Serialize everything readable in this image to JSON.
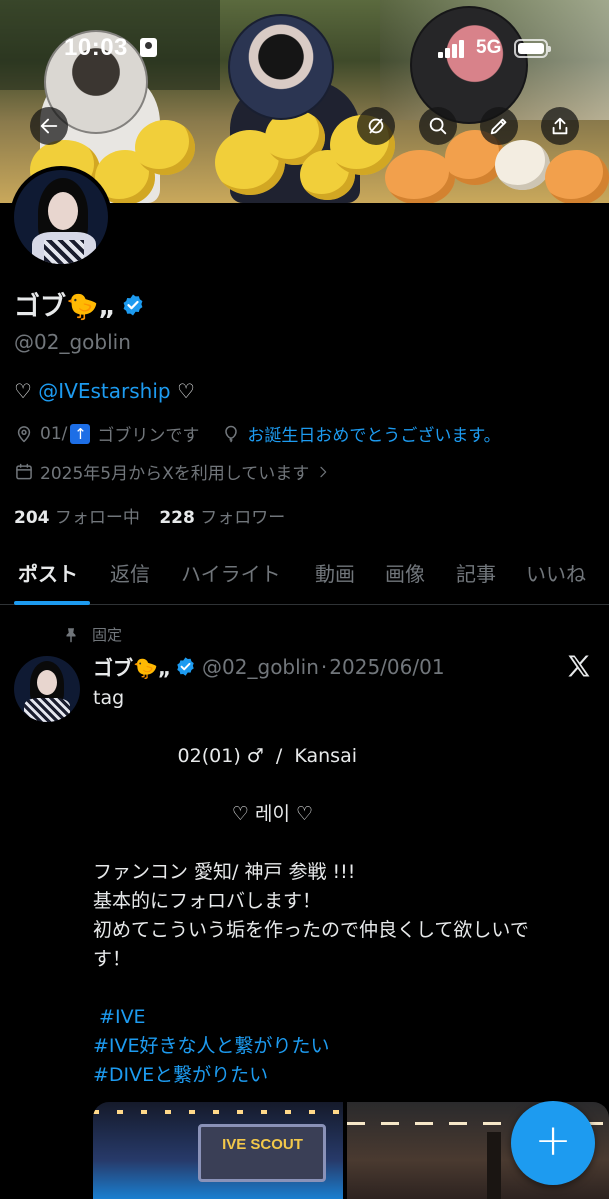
{
  "status_bar": {
    "time": "10:03",
    "network": "5G"
  },
  "header": {
    "back_icon": "arrow-left-icon",
    "actions": [
      "hide-icon",
      "search-icon",
      "edit-icon",
      "share-icon"
    ]
  },
  "profile": {
    "name": "ゴブ🐤„",
    "handle": "@02_goblin",
    "bio_prefix": "♡ ",
    "bio_link": "@IVEstarship",
    "bio_suffix": " ♡",
    "location_prefix": "01/",
    "location_mark": "↑",
    "location_suffix": " ゴブリンです",
    "birthday": "お誕生日おめでとうございます。",
    "joined": "2025年5月からXを利用しています",
    "following_count": "204",
    "following_label": "フォロー中",
    "followers_count": "228",
    "followers_label": "フォロワー"
  },
  "tabs": [
    "ポスト",
    "返信",
    "ハイライト",
    "動画",
    "画像",
    "記事",
    "いいね"
  ],
  "active_tab": 0,
  "post": {
    "pinned_label": "固定",
    "author_name": "ゴブ🐤„",
    "author_handle": "@02_goblin",
    "separator": "·",
    "date": "2025/06/01",
    "lines": [
      "tag",
      "",
      "              02(01) ♂  /  Kansai",
      "",
      "                       ♡ 레이 ♡",
      "",
      "ファンコン 愛知/ 神戸 参戦 !!!",
      "基本的にフォロバします！",
      "初めてこういう垢を作ったので仲良くして欲しいで",
      "す！",
      "",
      " #IVE",
      "#IVE好きな人と繋がりたい",
      "#DIVEと繋がりたい"
    ],
    "hashtag_line_indexes": [
      11,
      12,
      13
    ],
    "media_text": "IVE SCOUT"
  },
  "fab_label": "+",
  "colors": {
    "accent": "#1d9bf0",
    "text": "#e7e9ea",
    "muted": "#71767b",
    "background": "#000000"
  }
}
